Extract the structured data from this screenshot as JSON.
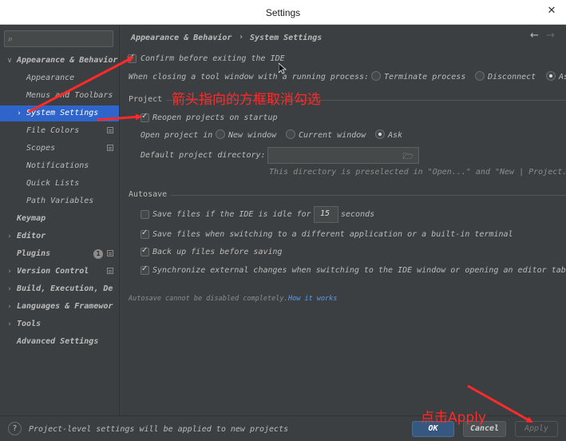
{
  "window": {
    "title": "Settings"
  },
  "sidebar": {
    "search_placeholder": "",
    "items": [
      {
        "label": "Appearance & Behavior",
        "expanded": true
      },
      {
        "label": "Appearance"
      },
      {
        "label": "Menus and Toolbars"
      },
      {
        "label": "System Settings",
        "selected": true
      },
      {
        "label": "File Colors"
      },
      {
        "label": "Scopes"
      },
      {
        "label": "Notifications"
      },
      {
        "label": "Quick Lists"
      },
      {
        "label": "Path Variables"
      },
      {
        "label": "Keymap"
      },
      {
        "label": "Editor"
      },
      {
        "label": "Plugins",
        "badge": "1"
      },
      {
        "label": "Version Control"
      },
      {
        "label": "Build, Execution, De"
      },
      {
        "label": "Languages & Framewor"
      },
      {
        "label": "Tools"
      },
      {
        "label": "Advanced Settings"
      }
    ]
  },
  "breadcrumb": {
    "parent": "Appearance & Behavior",
    "separator": "›",
    "current": "System Settings"
  },
  "main": {
    "confirm_exit": {
      "label": "Confirm before exiting the IDE",
      "checked": true
    },
    "tool_window_close": {
      "label": "When closing a tool window with a running process:",
      "options": [
        "Terminate process",
        "Disconnect",
        "As"
      ],
      "selected": "As"
    },
    "project": {
      "header": "Project",
      "reopen": {
        "label": "Reopen projects on startup",
        "checked": true
      },
      "open_in": {
        "label": "Open project in",
        "options": [
          "New window",
          "Current window",
          "Ask"
        ],
        "selected": "Ask"
      },
      "default_dir": {
        "label": "Default project directory:",
        "value": "",
        "hint": "This directory is preselected in \"Open...\" and \"New | Project."
      }
    },
    "autosave": {
      "header": "Autosave",
      "idle": {
        "label_before": "Save files if the IDE is idle for",
        "value": "15",
        "label_after": "seconds",
        "checked": false
      },
      "switching": {
        "label": "Save files when switching to a different application or a built-in terminal",
        "checked": true
      },
      "backup": {
        "label": "Back up files before saving",
        "checked": true
      },
      "sync": {
        "label": "Synchronize external changes when switching to the IDE window or opening an editor tab",
        "checked": true
      },
      "note": "Autosave cannot be disabled completely.",
      "note_link": "How it works"
    }
  },
  "footer": {
    "info": "Project-level settings will be applied to new projects",
    "ok": "OK",
    "cancel": "Cancel",
    "apply": "Apply"
  },
  "annotations": {
    "arrow_note": "箭头指向的方框取消勾选",
    "apply_note": "点击Apply",
    "color": "#ff2a2a"
  }
}
